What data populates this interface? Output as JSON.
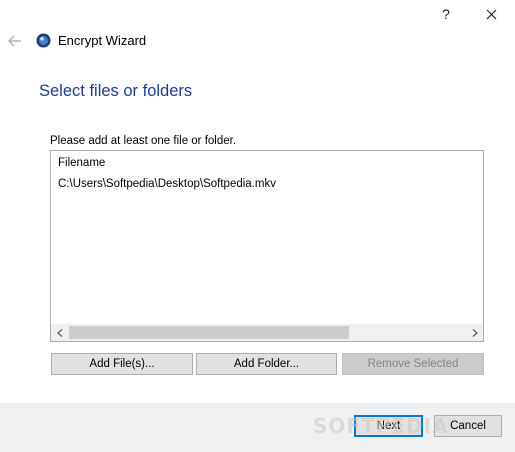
{
  "window": {
    "caption_help": "?",
    "title": "Encrypt Wizard"
  },
  "page": {
    "heading": "Select files or folders",
    "instruction": "Please add at least one file or folder."
  },
  "file_list": {
    "column_header": "Filename",
    "rows": [
      "C:\\Users\\Softpedia\\Desktop\\Softpedia.mkv"
    ]
  },
  "buttons": {
    "add_files": "Add File(s)...",
    "add_folder": "Add Folder...",
    "remove_selected": "Remove Selected",
    "next": "Next",
    "cancel": "Cancel"
  },
  "watermark": "SOFTPEDIA",
  "icons": {
    "back": "arrow-left-icon",
    "close": "close-icon",
    "app": "encrypt-app-icon"
  },
  "colors": {
    "heading": "#1c3d94",
    "focus_border": "#0078d7"
  }
}
